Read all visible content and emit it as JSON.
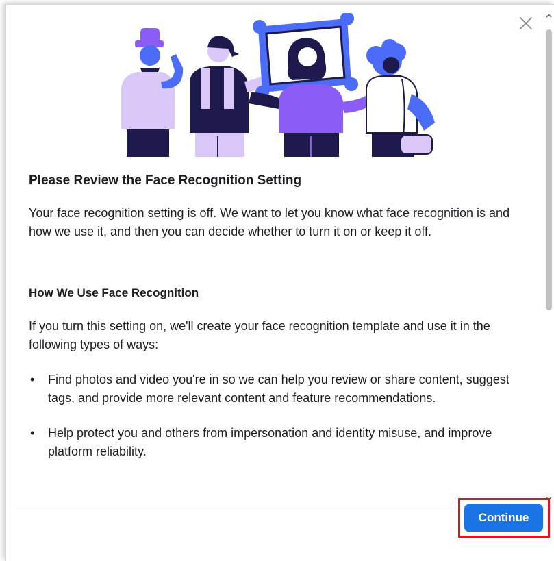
{
  "dialog": {
    "title": "Please Review the Face Recognition Setting",
    "intro": "Your face recognition setting is off. We want to let you know what face recognition is and how we use it, and then you can decide whether to turn it on or keep it off.",
    "section_title": "How We Use Face Recognition",
    "usage_intro": "If you turn this setting on, we'll create your face recognition template and use it in the following types of ways:",
    "bullets": [
      "Find photos and video you're in so we can help you review or share content, suggest tags, and provide more relevant content and feature recommendations.",
      "Help protect you and others from impersonation and identity misuse, and improve platform reliability."
    ],
    "bullet_symbol": "•",
    "continue_label": "Continue",
    "close_icon": "close-icon"
  },
  "colors": {
    "primary_blue": "#1b74e4",
    "illustration_blue": "#4a6cf7",
    "illustration_purple": "#8b5cf6",
    "illustration_lavender": "#d9c8f7",
    "dark_navy": "#1e1a4d",
    "highlight_red": "#e0141e",
    "text": "#1c1e21"
  }
}
